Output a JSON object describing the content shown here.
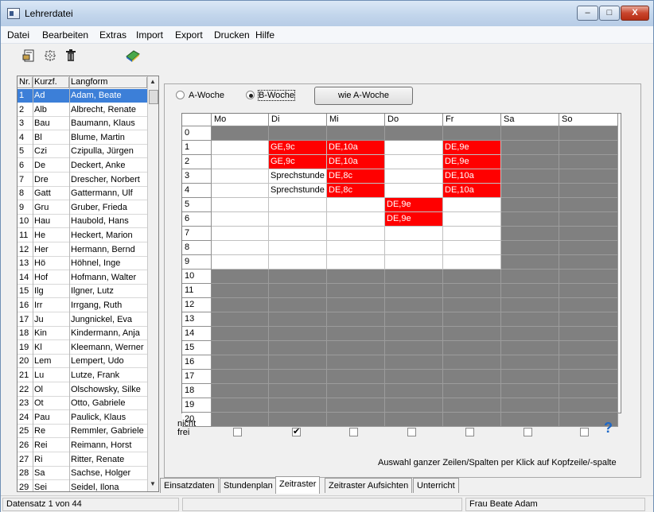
{
  "window": {
    "title": "Lehrerdatei",
    "buttons": [
      "–",
      "□",
      "X"
    ]
  },
  "menu": [
    "Datei",
    "Bearbeiten",
    "Extras",
    "Import",
    "Export",
    "Drucken",
    "Hilfe"
  ],
  "toolbar": [
    "new-record-icon",
    "crop-icon",
    "trash-icon",
    "book-icon"
  ],
  "list": {
    "headers": [
      "Nr.",
      "Kurzf.",
      "Langform"
    ],
    "selected_index": 0,
    "rows": [
      [
        "1",
        "Ad",
        "Adam, Beate"
      ],
      [
        "2",
        "Alb",
        "Albrecht, Renate"
      ],
      [
        "3",
        "Bau",
        "Baumann, Klaus"
      ],
      [
        "4",
        "Bl",
        "Blume, Martin"
      ],
      [
        "5",
        "Czi",
        "Czipulla, Jürgen"
      ],
      [
        "6",
        "De",
        "Deckert, Anke"
      ],
      [
        "7",
        "Dre",
        "Drescher, Norbert"
      ],
      [
        "8",
        "Gatt",
        "Gattermann, Ulf"
      ],
      [
        "9",
        "Gru",
        "Gruber, Frieda"
      ],
      [
        "10",
        "Hau",
        "Haubold, Hans"
      ],
      [
        "11",
        "He",
        "Heckert, Marion"
      ],
      [
        "12",
        "Her",
        "Hermann, Bernd"
      ],
      [
        "13",
        "Hö",
        "Höhnel, Inge"
      ],
      [
        "14",
        "Hof",
        "Hofmann, Walter"
      ],
      [
        "15",
        "Ilg",
        "Ilgner, Lutz"
      ],
      [
        "16",
        "Irr",
        "Irrgang, Ruth"
      ],
      [
        "17",
        "Ju",
        "Jungnickel, Eva"
      ],
      [
        "18",
        "Kin",
        "Kindermann, Anja"
      ],
      [
        "19",
        "Kl",
        "Kleemann, Werner"
      ],
      [
        "20",
        "Lem",
        "Lempert, Udo"
      ],
      [
        "21",
        "Lu",
        "Lutze, Frank"
      ],
      [
        "22",
        "Ol",
        "Olschowsky, Silke"
      ],
      [
        "23",
        "Ot",
        "Otto, Gabriele"
      ],
      [
        "24",
        "Pau",
        "Paulick, Klaus"
      ],
      [
        "25",
        "Re",
        "Remmler, Gabriele"
      ],
      [
        "26",
        "Rei",
        "Reimann, Horst"
      ],
      [
        "27",
        "Ri",
        "Ritter, Renate"
      ],
      [
        "28",
        "Sa",
        "Sachse, Holger"
      ],
      [
        "29",
        "Sei",
        "Seidel, Ilona"
      ]
    ]
  },
  "week": {
    "option_a": "A-Woche",
    "option_b": "B-Woche",
    "selected": "B",
    "copy_button": "wie A-Woche"
  },
  "grid": {
    "days": [
      "Mo",
      "Di",
      "Mi",
      "Do",
      "Fr",
      "Sa",
      "So"
    ],
    "periods": [
      "0",
      "1",
      "2",
      "3",
      "4",
      "5",
      "6",
      "7",
      "8",
      "9",
      "10",
      "11",
      "12",
      "13",
      "14",
      "15",
      "16",
      "17",
      "18",
      "19",
      "20"
    ],
    "free_periods": [
      1,
      9
    ],
    "free_days": [
      0,
      4
    ],
    "entries": [
      {
        "period": 1,
        "day": 1,
        "text": "GE,9c"
      },
      {
        "period": 1,
        "day": 2,
        "text": "DE,10a"
      },
      {
        "period": 1,
        "day": 4,
        "text": "DE,9e"
      },
      {
        "period": 2,
        "day": 1,
        "text": "GE,9c"
      },
      {
        "period": 2,
        "day": 2,
        "text": "DE,10a"
      },
      {
        "period": 2,
        "day": 4,
        "text": "DE,9e"
      },
      {
        "period": 3,
        "day": 1,
        "text": "Sprechstunde",
        "type": "note"
      },
      {
        "period": 3,
        "day": 2,
        "text": "DE,8c"
      },
      {
        "period": 3,
        "day": 4,
        "text": "DE,10a"
      },
      {
        "period": 4,
        "day": 1,
        "text": "Sprechstunde",
        "type": "note"
      },
      {
        "period": 4,
        "day": 2,
        "text": "DE,8c"
      },
      {
        "period": 4,
        "day": 4,
        "text": "DE,10a"
      },
      {
        "period": 5,
        "day": 3,
        "text": "DE,9e"
      },
      {
        "period": 6,
        "day": 3,
        "text": "DE,9e"
      }
    ]
  },
  "nicht_frei": {
    "label_line1": "nicht",
    "label_line2": "frei",
    "checked": [
      false,
      true,
      false,
      false,
      false,
      false,
      false
    ]
  },
  "hint": "Auswahl ganzer Zeilen/Spalten per Klick auf Kopfzeile/-spalte",
  "tabs": [
    "Einsatzdaten",
    "Stundenplan",
    "Zeitraster",
    "Zeitraster Aufsichten",
    "Unterricht"
  ],
  "active_tab": "Zeitraster",
  "status": {
    "record": "Datensatz 1 von 44",
    "user": "Frau Beate Adam"
  }
}
